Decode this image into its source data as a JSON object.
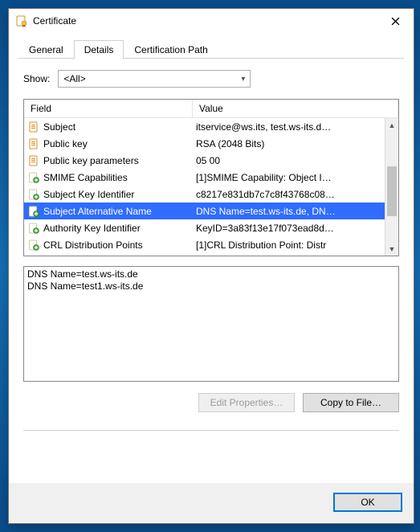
{
  "window": {
    "title": "Certificate"
  },
  "tabs": [
    {
      "label": "General",
      "active": false
    },
    {
      "label": "Details",
      "active": true
    },
    {
      "label": "Certification Path",
      "active": false
    }
  ],
  "show": {
    "label": "Show:",
    "value": "<All>"
  },
  "columns": {
    "field": "Field",
    "value": "Value"
  },
  "rows": [
    {
      "icon": "doc",
      "field": "Subject",
      "value": "itservice@ws.its, test.ws-its.d…",
      "selected": false
    },
    {
      "icon": "doc",
      "field": "Public key",
      "value": "RSA (2048 Bits)",
      "selected": false
    },
    {
      "icon": "doc",
      "field": "Public key parameters",
      "value": "05 00",
      "selected": false
    },
    {
      "icon": "ext",
      "field": "SMIME Capabilities",
      "value": "[1]SMIME Capability: Object I…",
      "selected": false
    },
    {
      "icon": "ext",
      "field": "Subject Key Identifier",
      "value": "c8217e831db7c7c8f43768c08…",
      "selected": false
    },
    {
      "icon": "ext",
      "field": "Subject Alternative Name",
      "value": "DNS Name=test.ws-its.de, DN…",
      "selected": true
    },
    {
      "icon": "ext",
      "field": "Authority Key Identifier",
      "value": "KeyID=3a83f13e17f073ead8d…",
      "selected": false
    },
    {
      "icon": "ext",
      "field": "CRL Distribution Points",
      "value": "[1]CRL Distribution Point: Distr",
      "selected": false
    }
  ],
  "detail_text": "DNS Name=test.ws-its.de\nDNS Name=test1.ws-its.de",
  "buttons": {
    "edit_properties": "Edit Properties…",
    "copy_to_file": "Copy to File…",
    "ok": "OK"
  }
}
